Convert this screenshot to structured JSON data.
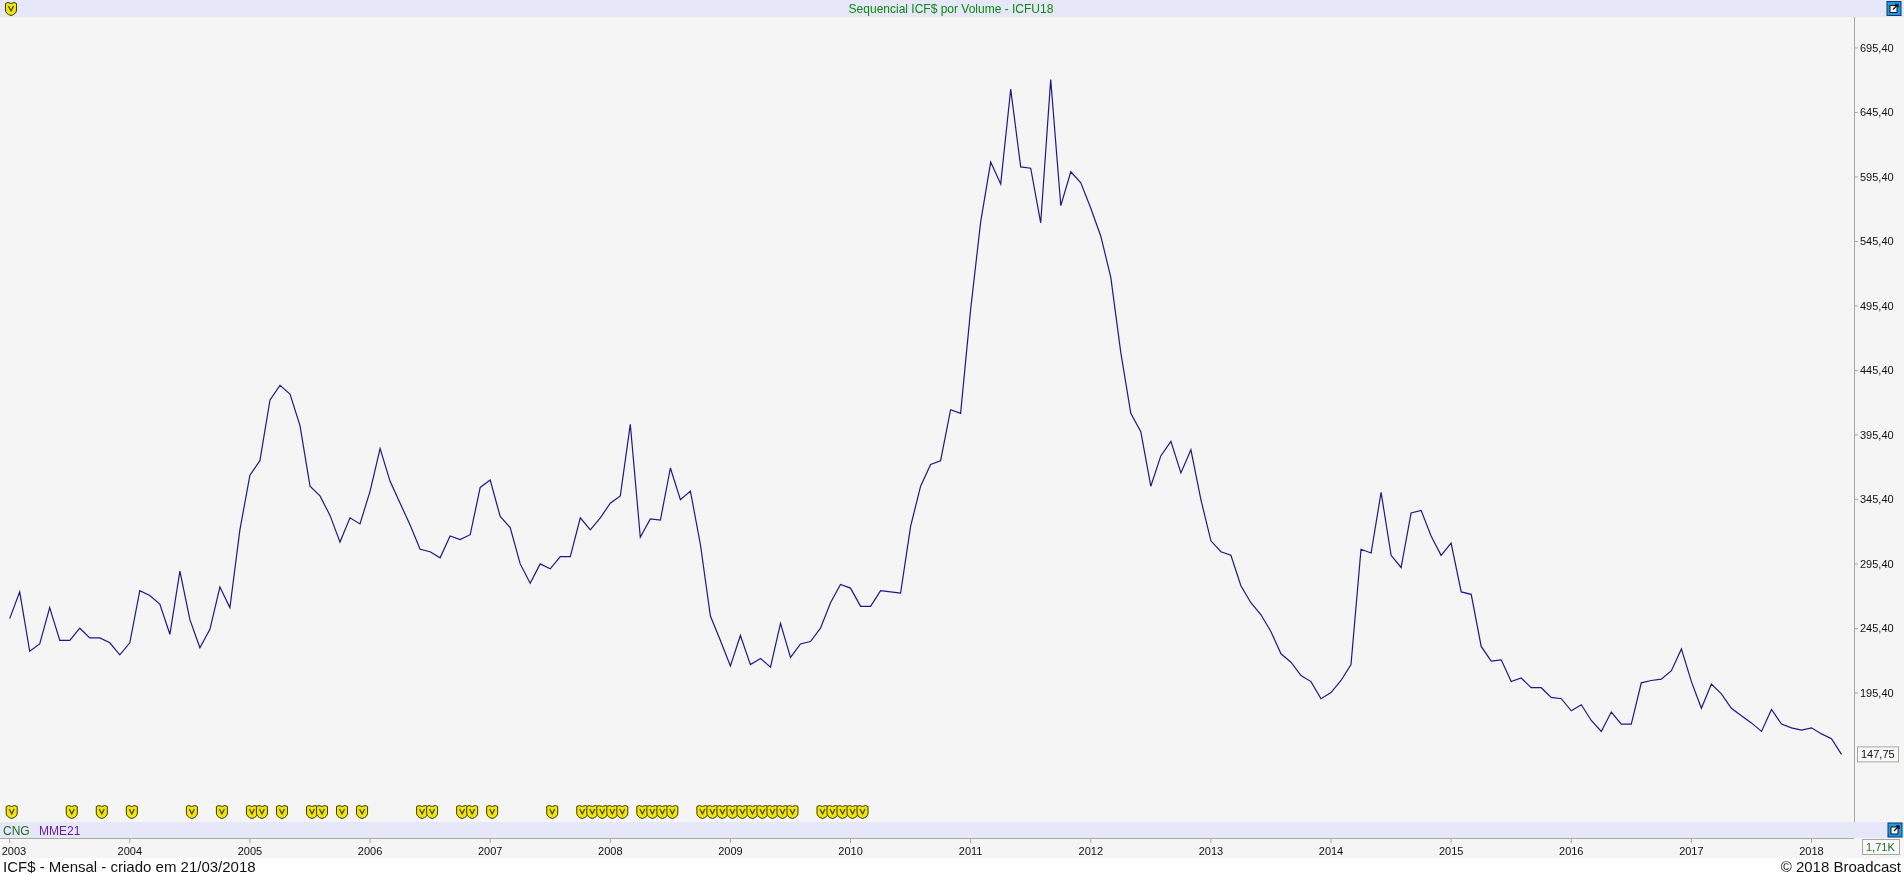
{
  "header": {
    "title": "Sequencial ICF$ por Volume - ICFU18"
  },
  "chart": {
    "chart_data": {
      "type": "line",
      "ylim": [
        95.4,
        719.4
      ],
      "yticks": [
        {
          "value": 195.4,
          "label": "195,40"
        },
        {
          "value": 245.4,
          "label": "245,40"
        },
        {
          "value": 295.4,
          "label": "295,40"
        },
        {
          "value": 345.4,
          "label": "345,40"
        },
        {
          "value": 395.4,
          "label": "395,40"
        },
        {
          "value": 445.4,
          "label": "445,40"
        },
        {
          "value": 495.4,
          "label": "495,40"
        },
        {
          "value": 545.4,
          "label": "545,40"
        },
        {
          "value": 595.4,
          "label": "595,40"
        },
        {
          "value": 645.4,
          "label": "645,40"
        },
        {
          "value": 695.4,
          "label": "695,40"
        }
      ],
      "series": [
        {
          "color": "#1a1a8c",
          "values": [
            253.1,
            273.8,
            227.7,
            233.4,
            261.6,
            236.2,
            236.2,
            245.6,
            238.1,
            238.1,
            234.3,
            224.9,
            234.3,
            274.8,
            271.0,
            264.4,
            240.9,
            289.8,
            252.2,
            230.5,
            244.7,
            277.6,
            261.6,
            321.8,
            364.2,
            375.5,
            422.5,
            433.8,
            427.2,
            402.7,
            355.7,
            348.2,
            333.1,
            312.4,
            331.2,
            326.5,
            351.9,
            384.9,
            359.5,
            342.5,
            325.6,
            306.8,
            304.9,
            300.2,
            317.1,
            314.3,
            318.1,
            354.8,
            360.4,
            332.2,
            323.7,
            295.5,
            280.4,
            295.5,
            291.7,
            301.1,
            301.1,
            331.2,
            321.8,
            331.2,
            342.5,
            348.2,
            403.7,
            316.2,
            330.3,
            329.4,
            369.8,
            345.3,
            351.9,
            310.5,
            255.0,
            236.2,
            216.4,
            240.0,
            217.4,
            222.1,
            215.5,
            249.4,
            223.0,
            233.4,
            235.3,
            245.6,
            265.4,
            279.5,
            276.7,
            262.5,
            262.5,
            274.8,
            273.8,
            272.9,
            324.6,
            355.7,
            372.6,
            375.5,
            415.0,
            412.2,
            493.1,
            560.8,
            606.9,
            590.0,
            663.4,
            603.2,
            602.2,
            559.9,
            670.9,
            573.1,
            599.4,
            590.9,
            571.2,
            549.5,
            517.6,
            459.2,
            412.2,
            398.0,
            355.7,
            379.2,
            390.5,
            366.0,
            383.9,
            345.3,
            313.4,
            304.9,
            302.1,
            278.5,
            265.4,
            256.0,
            242.8,
            225.8,
            219.3,
            208.9,
            204.2,
            191.0,
            195.7,
            205.1,
            217.4,
            306.8,
            303.9,
            351.0,
            302.1,
            292.7,
            335.0,
            336.9,
            317.1,
            302.1,
            311.5,
            273.8,
            271.9,
            231.5,
            220.2,
            221.1,
            204.2,
            207.0,
            199.5,
            199.5,
            192.0,
            191.0,
            181.6,
            186.3,
            174.1,
            165.6,
            180.7,
            171.3,
            171.3,
            203.3,
            205.1,
            206.1,
            212.7,
            229.6,
            204.2,
            183.5,
            202.3,
            194.8,
            183.5,
            177.8,
            172.2,
            165.6,
            182.6,
            171.3,
            168.4,
            166.6,
            168.4,
            163.7,
            160.0,
            147.8
          ]
        }
      ]
    },
    "last_value": "147,75",
    "year_labels": [
      "2003",
      "2004",
      "2005",
      "2006",
      "2007",
      "2008",
      "2009",
      "2010",
      "2011",
      "2012",
      "2013",
      "2014",
      "2015",
      "2016",
      "2017",
      "2018"
    ],
    "indicators": [
      {
        "label": "CNG",
        "color": "#1e6b1e"
      },
      {
        "label": "MME21",
        "color": "#6a1fa0"
      }
    ],
    "volume_reading": "1,71K"
  },
  "footer": {
    "left": "ICF$ - Mensal - criado em 21/03/2018",
    "right": "© 2018 Broadcast"
  }
}
